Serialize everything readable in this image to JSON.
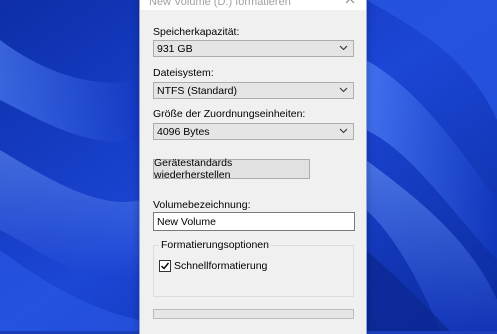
{
  "dialog": {
    "title": "New Volume (D:) formatieren",
    "capacity": {
      "label": "Speicherkapazität:",
      "value": "931 GB"
    },
    "filesystem": {
      "label": "Dateisystem:",
      "value": "NTFS (Standard)"
    },
    "allocation": {
      "label": "Größe der Zuordnungseinheiten:",
      "value": "4096 Bytes"
    },
    "restore_defaults_label": "Gerätestandards wiederherstellen",
    "volume_label": {
      "label": "Volumebezeichnung:",
      "value": "New Volume"
    },
    "format_options": {
      "title": "Formatierungsoptionen",
      "quick_format_label": "Schnellformatierung",
      "quick_format_checked": true
    },
    "progress": 0
  },
  "colors": {
    "wallpaper_dark": "#0a1f8f",
    "wallpaper_light": "#3d6cf0",
    "dialog_bg": "#f0f0f0",
    "progress_fill": "#06b025"
  },
  "icons": {
    "close": "close-icon",
    "dropdown": "chevron-down-icon",
    "check": "checkmark-icon"
  }
}
